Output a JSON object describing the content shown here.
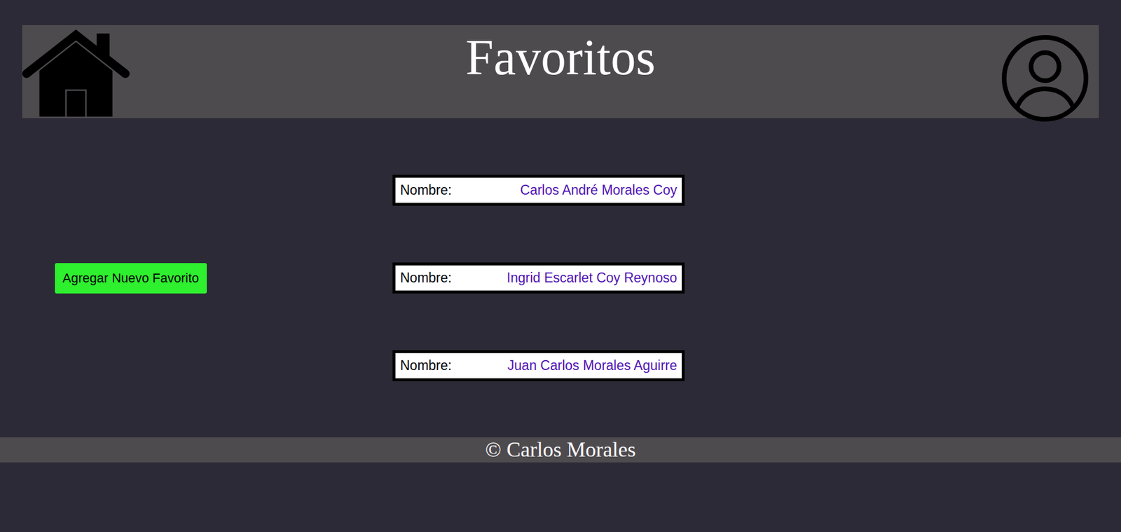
{
  "window": {
    "title": "Favoritos"
  },
  "actions": {
    "add_button": "Agregar Nuevo Favorito"
  },
  "favorites": [
    {
      "label": "Nombre:",
      "name": "Carlos André Morales Coy"
    },
    {
      "label": "Nombre:",
      "name": "Ingrid Escarlet Coy Reynoso"
    },
    {
      "label": "Nombre:",
      "name": "Juan Carlos Morales Aguirre"
    }
  ],
  "footer": {
    "text": "© Carlos Morales"
  }
}
